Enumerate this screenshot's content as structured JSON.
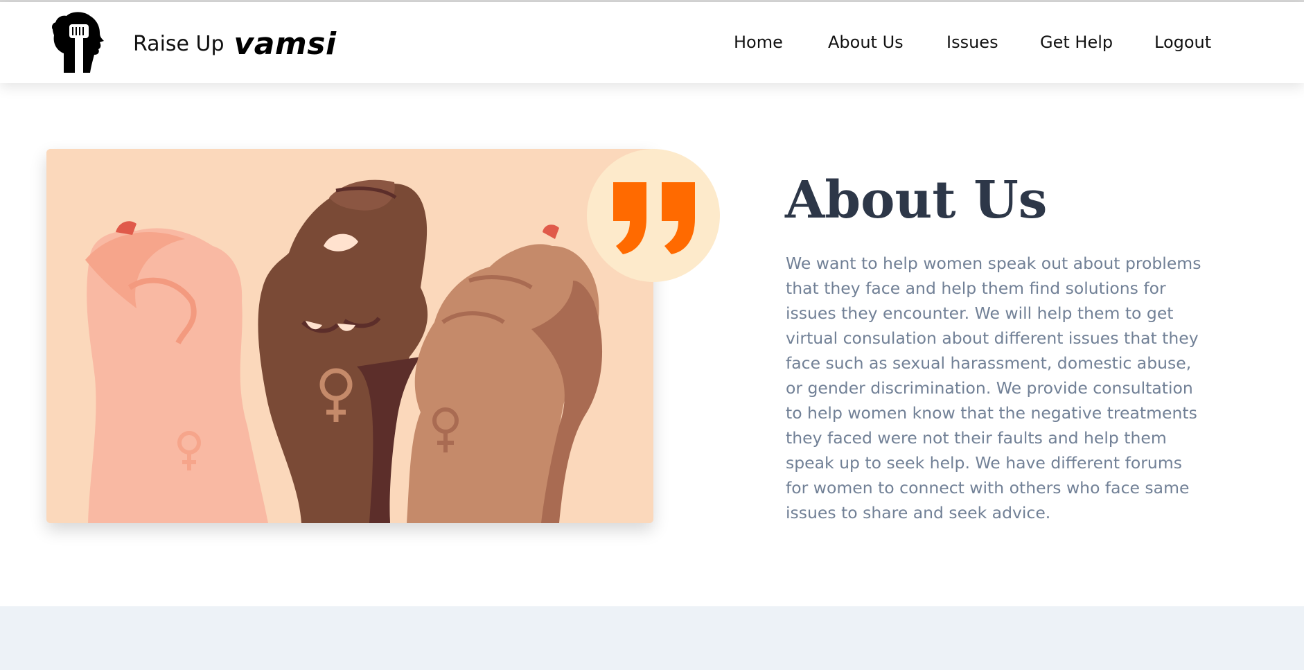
{
  "brand": {
    "name": "Raise Up",
    "username": "vamsi",
    "logo_icon": "raised-fist-woman-profile-icon"
  },
  "nav": {
    "items": [
      {
        "label": "Home"
      },
      {
        "label": "About Us"
      },
      {
        "label": "Issues"
      },
      {
        "label": "Get Help"
      },
      {
        "label": "Logout"
      }
    ]
  },
  "about": {
    "title": "About Us",
    "body": "We want to help women speak out about problems that they face and help them find solutions for issues they encounter. We will help them to get virtual consulation about different issues that they face such as sexual harassment, domestic abuse, or gender discrimination. We provide consultation to help women know that the negative treatments they faced were not their faults and help them speak up to seek help. We have different forums for women to connect with others who face same issues to share and seek advice."
  },
  "hero": {
    "illustration": "three-raised-fists-with-female-symbols",
    "quote_icon": "quote-mark-icon"
  },
  "colors": {
    "accent": "#ff6a00",
    "heading": "#2d3748",
    "body_text": "#718096",
    "footer_band": "#edf2f7",
    "hero_bg": "#fbd8bb"
  }
}
